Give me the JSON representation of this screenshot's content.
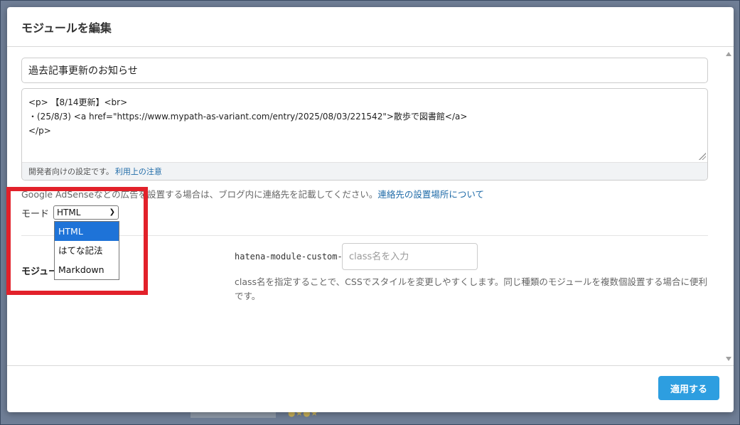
{
  "modal": {
    "title": "モジュールを編集",
    "module_title_value": "過去記事更新のお知らせ",
    "code_lines": [
      "<p> 【8/14更新】<br>",
      "・(25/8/3) <a href=\"https://www.mypath-as-variant.com/entry/2025/08/03/221542\">散歩で図書館</a>",
      "</p>"
    ],
    "code_footer_text": "開発者向けの設定です。",
    "code_footer_link": "利用上の注意",
    "adsense_text": "Google AdSenseなどの広告を設置する場合は、ブログ内に連絡先を記載してください。",
    "adsense_link": "連絡先の設置場所について",
    "mode_label": "モード",
    "mode_selected": "HTML",
    "mode_options": [
      "HTML",
      "はてな記法",
      "Markdown"
    ],
    "section_label": "モジュー",
    "class_prefix": "hatena-module-custom-",
    "class_placeholder": "class名を入力",
    "class_help": "class名を指定することで、CSSでスタイルを変更しやすくします。同じ種類のモジュールを複数個設置する場合に便利です。",
    "apply_label": "適用する"
  },
  "colors": {
    "accent_button": "#2d9ee0",
    "link": "#1f6ba8",
    "highlight": "#e2212a",
    "selected_option": "#1e73d8"
  }
}
